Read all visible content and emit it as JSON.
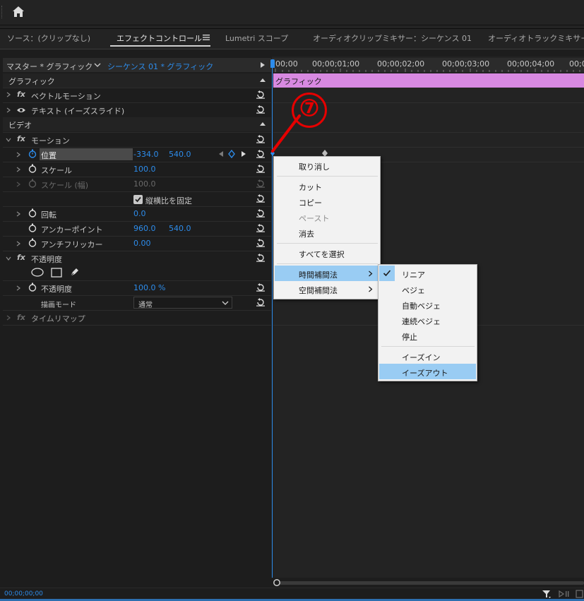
{
  "tabs": {
    "source": "ソース：(クリップなし)",
    "effect_controls": "エフェクトコントロール",
    "lumetri": "Lumetri スコープ",
    "audio_clip_mixer": "オーディオクリップミキサー：シーケンス 01",
    "audio_track_mixer": "オーディオトラックミキサー"
  },
  "sequence_header": {
    "master": "マスター * グラフィック",
    "sequence": "シーケンス 01 * グラフィック"
  },
  "ruler": [
    "00;00",
    "00;00;01;00",
    "00;00;02;00",
    "00;00;03;00",
    "00;00;04;00",
    "00;0"
  ],
  "clip_label": "グラフィック",
  "effects": {
    "graphic_section": "グラフィック",
    "vector_motion": "ベクトルモーション",
    "text": "テキスト (イーズスライド)",
    "video_section": "ビデオ",
    "motion": "モーション",
    "position_label": "位置",
    "position_x": "-334.0",
    "position_y": "540.0",
    "scale_label": "スケール",
    "scale_value": "100.0",
    "scale_width_label": "スケール (幅)",
    "scale_width_value": "100.0",
    "uniform_scale": "縦横比を固定",
    "rotation_label": "回転",
    "rotation_value": "0.0",
    "anchor_label": "アンカーポイント",
    "anchor_x": "960.0",
    "anchor_y": "540.0",
    "antiflicker_label": "アンチフリッカー",
    "antiflicker_value": "0.00",
    "opacity_section": "不透明度",
    "opacity_label": "不透明度",
    "opacity_value": "100.0 %",
    "blend_label": "描画モード",
    "blend_value": "通常",
    "time_remap": "タイムリマップ"
  },
  "timecode": "00;00;00;00",
  "context_menu": {
    "undo": "取り消し",
    "cut": "カット",
    "copy": "コピー",
    "paste": "ペースト",
    "clear": "消去",
    "select_all": "すべてを選択",
    "temporal": "時間補間法",
    "spatial": "空間補間法"
  },
  "submenu": {
    "linear": "リニア",
    "bezier": "ベジェ",
    "auto_bezier": "自動ベジェ",
    "continuous_bezier": "連続ベジェ",
    "hold": "停止",
    "ease_in": "イーズイン",
    "ease_out": "イーズアウト"
  },
  "annotation_number": "⑦",
  "colors": {
    "accent": "#2d8ceb",
    "clip": "#d889e1",
    "highlight": "#99ccf3",
    "annotation": "#e60000"
  }
}
